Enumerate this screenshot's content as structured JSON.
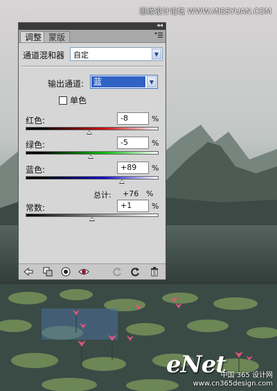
{
  "watermarks": {
    "top": "思缘设计论坛 WWW.MISSYUAN.COM",
    "logo": "eNet",
    "bottom_line1": "中国 365 设计网",
    "bottom_line2": "www.cn365design.com"
  },
  "panel": {
    "collapse_glyph": "◂◂",
    "tabs": [
      {
        "label": "调整",
        "active": true
      },
      {
        "label": "蒙版",
        "active": false
      }
    ],
    "menu_icon": "panel-menu-icon",
    "preset_label": "通道混和器",
    "preset_value": "自定",
    "output_channel_label": "输出通道:",
    "output_channel_value": "蓝",
    "monochrome_label": "单色",
    "monochrome_checked": false,
    "sliders": [
      {
        "label": "红色:",
        "value": "-8",
        "unit": "%",
        "amount": -8,
        "color": "#d01010"
      },
      {
        "label": "绿色:",
        "value": "-5",
        "unit": "%",
        "amount": -5,
        "color": "#10c010"
      },
      {
        "label": "蓝色:",
        "value": "+89",
        "unit": "%",
        "amount": 89,
        "color": "#1010d0"
      }
    ],
    "total_label": "总计:",
    "total_value": "+76",
    "total_unit": "%",
    "constant": {
      "label": "常数:",
      "value": "+1",
      "unit": "%",
      "amount": 1
    },
    "toolbar_icons": [
      "back-arrow-icon",
      "clip-layer-icon",
      "eye-visibility-icon",
      "view-previous-icon",
      "reset-icon",
      "refresh-icon",
      "trash-icon"
    ]
  },
  "colors": {
    "selection_blue": "#3163c5",
    "panel_bg": "#d6d6d6"
  }
}
